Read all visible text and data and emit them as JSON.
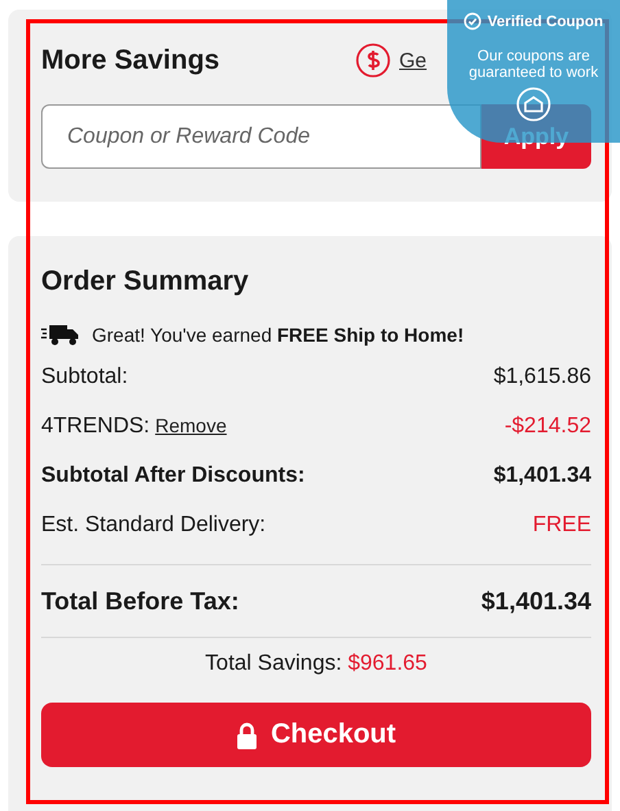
{
  "savings": {
    "title": "More Savings",
    "rewards_link": "Ge",
    "coupon_field": {
      "placeholder": "Coupon or Reward Code"
    },
    "apply_button": "Apply"
  },
  "coupon_popup": {
    "title": "Verified Coupon",
    "message": "Our coupons are guaranteed to work"
  },
  "summary": {
    "title": "Order Summary",
    "shipping_note": "Great! You've earned **FREE Ship to Home!**",
    "rows": [
      {
        "label": "Subtotal:",
        "value": "$1,615.86",
        "bold": false,
        "accent": false
      },
      {
        "label": "4TRENDS:",
        "link": "Remove",
        "value": "-$214.52",
        "bold": false,
        "accent": true
      },
      {
        "label": "Subtotal After Discounts:",
        "value": "$1,401.34",
        "bold": true,
        "accent": false
      },
      {
        "label": "Est. Standard Delivery:",
        "value": "FREE",
        "bold": false,
        "accent": true
      }
    ],
    "total": {
      "label": "Total Before Tax:",
      "value": "$1,401.34"
    },
    "savings_line": {
      "label": "Total Savings:",
      "value": "$961.65"
    },
    "checkout_button": "Checkout"
  }
}
